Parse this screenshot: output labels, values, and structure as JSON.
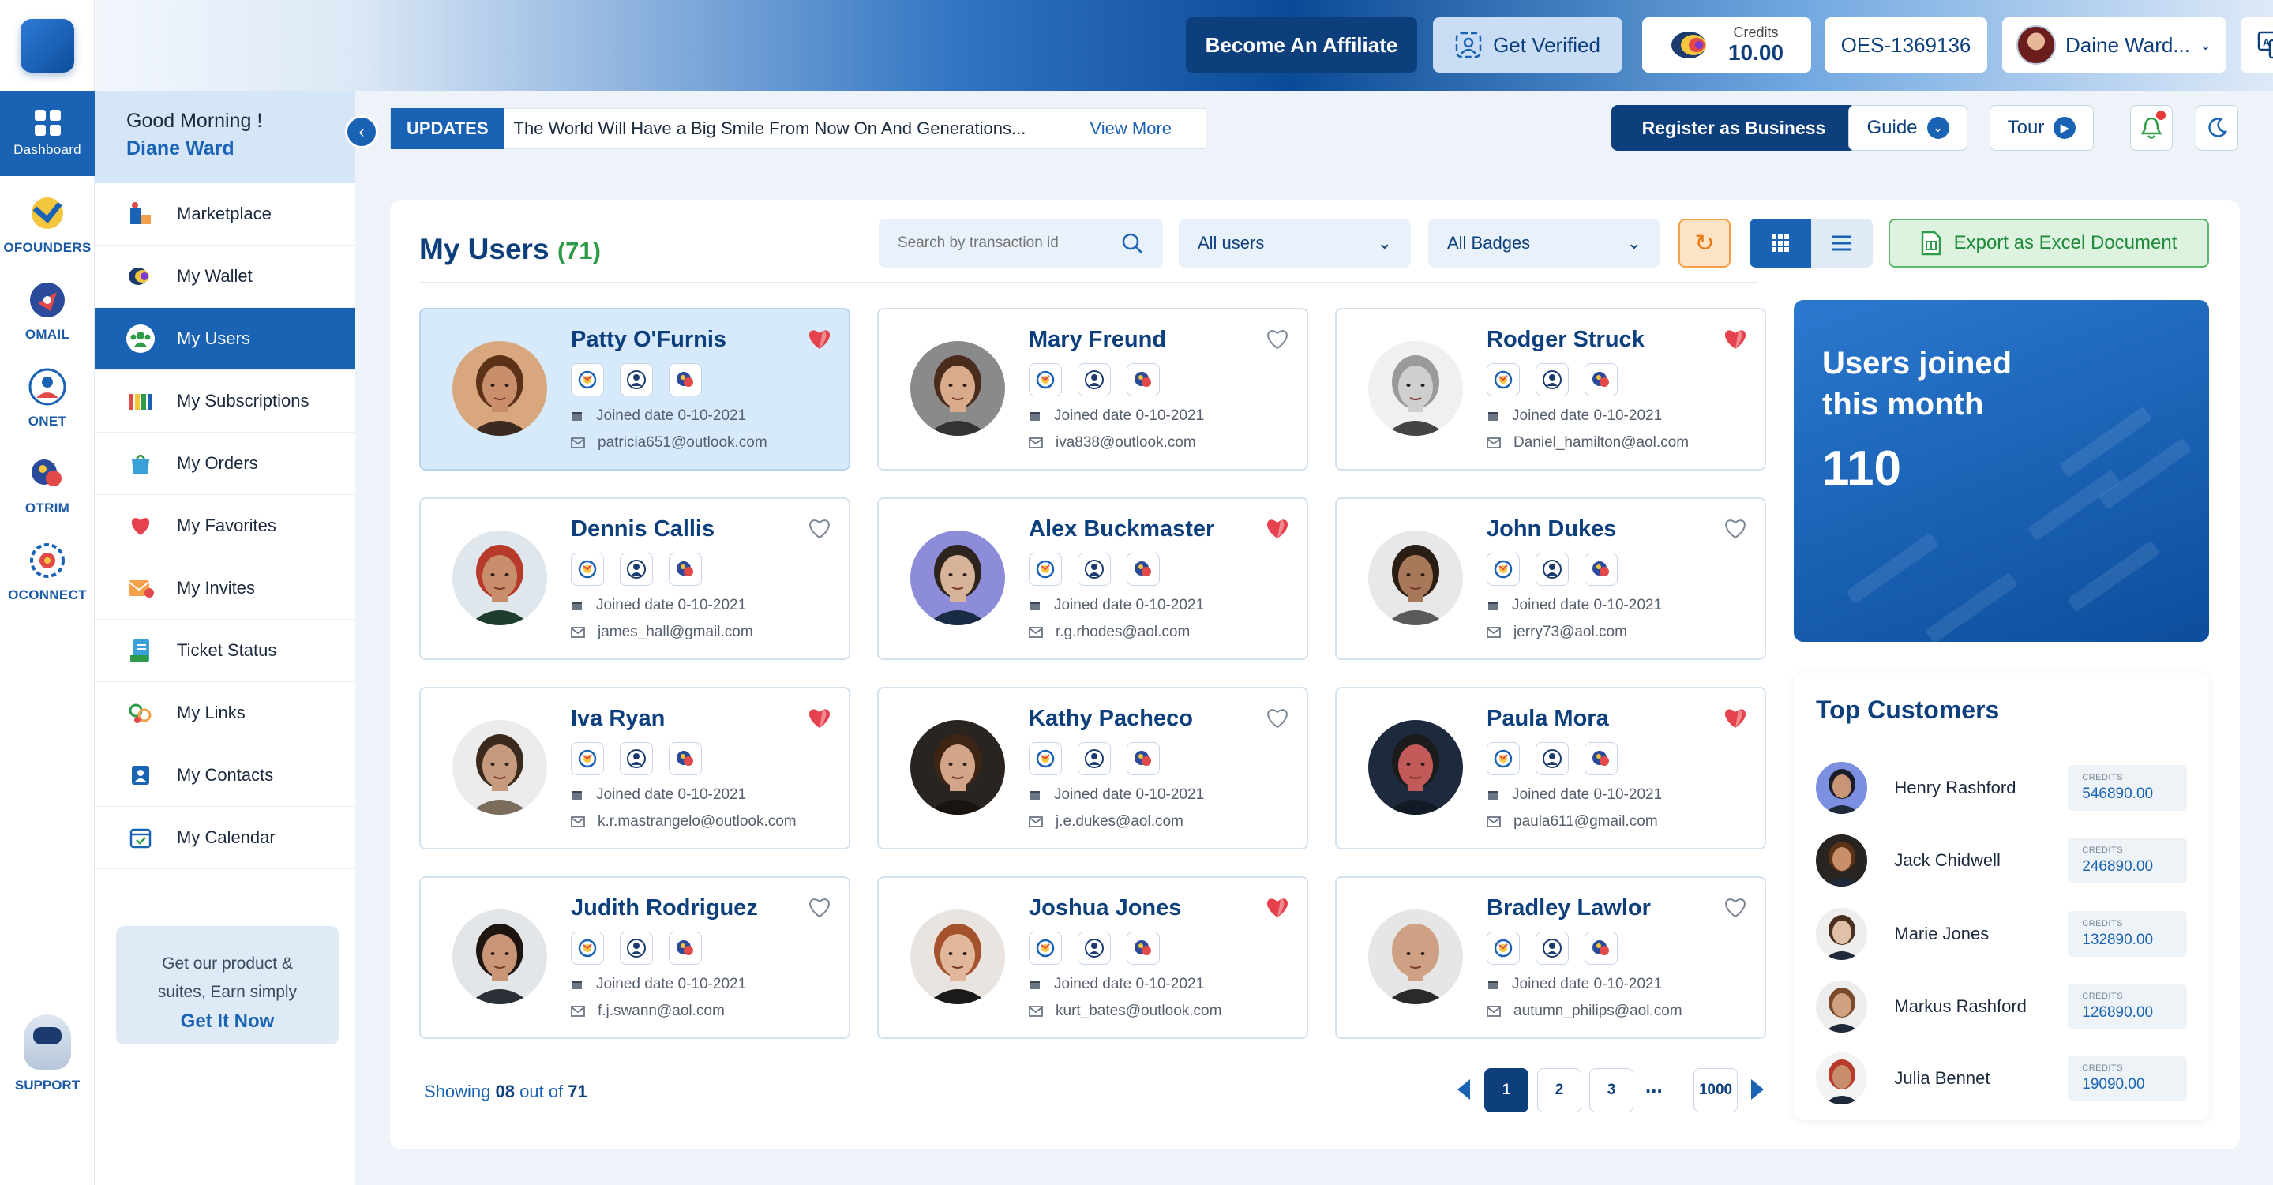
{
  "header": {
    "affiliate_label": "Become An Affiliate",
    "verify_label": "Get Verified",
    "credits_label": "Credits",
    "credits_value": "10.00",
    "account_id": "OES-1369136",
    "user_name": "Daine Ward..."
  },
  "rail": {
    "items": [
      {
        "label": "Dashboard",
        "icon": "dashboard-icon"
      },
      {
        "label": "OFOUNDERS",
        "icon": "ofounders-icon"
      },
      {
        "label": "OMAIL",
        "icon": "omail-icon"
      },
      {
        "label": "ONET",
        "icon": "onet-icon"
      },
      {
        "label": "OTRIM",
        "icon": "otrim-icon"
      },
      {
        "label": "OCONNECT",
        "icon": "oconnect-icon"
      }
    ],
    "support_label": "SUPPORT"
  },
  "sidebar": {
    "greeting": "Good Morning !",
    "user": "Diane Ward",
    "items": [
      {
        "label": "Marketplace",
        "icon": "marketplace-icon"
      },
      {
        "label": "My Wallet",
        "icon": "wallet-icon"
      },
      {
        "label": "My Users",
        "icon": "users-icon"
      },
      {
        "label": "My Subscriptions",
        "icon": "subscriptions-icon"
      },
      {
        "label": "My Orders",
        "icon": "orders-icon"
      },
      {
        "label": "My Favorites",
        "icon": "heart-icon"
      },
      {
        "label": "My Invites",
        "icon": "invite-icon"
      },
      {
        "label": "Ticket Status",
        "icon": "ticket-icon"
      },
      {
        "label": "My Links",
        "icon": "links-icon"
      },
      {
        "label": "My Contacts",
        "icon": "contacts-icon"
      },
      {
        "label": "My Calendar",
        "icon": "calendar-icon"
      }
    ],
    "promo_line1": "Get our product &",
    "promo_line2": "suites, Earn simply",
    "promo_link": "Get It Now"
  },
  "subheader": {
    "updates_tag": "UPDATES",
    "updates_text": "The World Will Have a Big Smile From Now On And Generations...",
    "view_more": "View More",
    "register_label": "Register as Business",
    "guide_label": "Guide",
    "tour_label": "Tour"
  },
  "main": {
    "title": "My Users",
    "count": "(71)",
    "search_placeholder": "Search by transaction id",
    "filter_users": "All users",
    "filter_badges": "All Badges",
    "export_label": "Export as Excel Document"
  },
  "users": [
    {
      "name": "Patty O'Furnis",
      "date": "Joined date 0-10-2021",
      "email": "patricia651@outlook.com",
      "favorite": true,
      "highlight": true,
      "skin": "#c98f6b",
      "hair": "#5b3218",
      "bg": "#d8a77e",
      "cloth": "#3b2a20"
    },
    {
      "name": "Mary Freund",
      "date": "Joined date 0-10-2021",
      "email": "iva838@outlook.com",
      "favorite": false,
      "highlight": false,
      "skin": "#d9ab8c",
      "hair": "#4a2c1c",
      "bg": "#8a8a8a",
      "cloth": "#333333"
    },
    {
      "name": "Rodger Struck",
      "date": "Joined date 0-10-2021",
      "email": "Daniel_hamilton@aol.com",
      "favorite": true,
      "highlight": false,
      "skin": "#cfcfcf",
      "hair": "#9a9a9a",
      "bg": "#f0f0f0",
      "cloth": "#444444"
    },
    {
      "name": "Dennis Callis",
      "date": "Joined date 0-10-2021",
      "email": "james_hall@gmail.com",
      "favorite": false,
      "highlight": false,
      "skin": "#c88e6b",
      "hair": "#b73a2a",
      "bg": "#dfe6ec",
      "cloth": "#1e3d2c"
    },
    {
      "name": "Alex Buckmaster",
      "date": "Joined date 0-10-2021",
      "email": "r.g.rhodes@aol.com",
      "favorite": true,
      "highlight": false,
      "skin": "#d7b39a",
      "hair": "#2d241d",
      "bg": "#8d8cd9",
      "cloth": "#1a2b45"
    },
    {
      "name": "John Dukes",
      "date": "Joined date 0-10-2021",
      "email": "jerry73@aol.com",
      "favorite": false,
      "highlight": false,
      "skin": "#a8785a",
      "hair": "#2a1d14",
      "bg": "#e8e8e8",
      "cloth": "#5a5a5a"
    },
    {
      "name": "Iva Ryan",
      "date": "Joined date 0-10-2021",
      "email": "k.r.mastrangelo@outlook.com",
      "favorite": true,
      "highlight": false,
      "skin": "#c59a7d",
      "hair": "#3a2a1e",
      "bg": "#ececec",
      "cloth": "#7c6c5c"
    },
    {
      "name": "Kathy Pacheco",
      "date": "Joined date 0-10-2021",
      "email": "j.e.dukes@aol.com",
      "favorite": false,
      "highlight": false,
      "skin": "#d2a588",
      "hair": "#3d2415",
      "bg": "#2a2420",
      "cloth": "#1a1410"
    },
    {
      "name": "Paula Mora",
      "date": "Joined date 0-10-2021",
      "email": "paula611@gmail.com",
      "favorite": true,
      "highlight": false,
      "skin": "#c25a5a",
      "hair": "#1b1b1b",
      "bg": "#1d2a3e",
      "cloth": "#121a26"
    },
    {
      "name": "Judith Rodriguez",
      "date": "Joined date 0-10-2021",
      "email": "f.j.swann@aol.com",
      "favorite": false,
      "highlight": false,
      "skin": "#c89676",
      "hair": "#1e1510",
      "bg": "#e3e6e8",
      "cloth": "#2b3036"
    },
    {
      "name": "Joshua Jones",
      "date": "Joined date 0-10-2021",
      "email": "kurt_bates@outlook.com",
      "favorite": true,
      "highlight": false,
      "skin": "#e0b79a",
      "hair": "#a3522c",
      "bg": "#e9e4df",
      "cloth": "#1a1a1a"
    },
    {
      "name": "Bradley Lawlor",
      "date": "Joined date 0-10-2021",
      "email": "autumn_philips@aol.com",
      "favorite": false,
      "highlight": false,
      "skin": "#cfa184",
      "hair": "#cfa184",
      "bg": "#e6e6e6",
      "cloth": "#2a2a2a"
    }
  ],
  "pagination": {
    "showing_prefix": "Showing",
    "showing_count": "08",
    "showing_mid": "out of",
    "showing_total": "71",
    "pages": [
      "1",
      "2",
      "3"
    ],
    "ellipsis": "...",
    "last_page": "1000",
    "current_page": "1"
  },
  "stats": {
    "title": "Users joined this month",
    "value": "110"
  },
  "top_customers": {
    "title": "Top Customers",
    "credits_label": "CREDITS",
    "items": [
      {
        "name": "Henry Rashford",
        "credits": "546890.00",
        "skin": "#c89676",
        "bg": "#7d8fe0",
        "hair": "#1b1b2a"
      },
      {
        "name": "Jack Chidwell",
        "credits": "246890.00",
        "skin": "#c98f6b",
        "bg": "#2a2420",
        "hair": "#5b3218"
      },
      {
        "name": "Marie Jones",
        "credits": "132890.00",
        "skin": "#e0c0a8",
        "bg": "#f0eeec",
        "hair": "#4a3020"
      },
      {
        "name": "Markus Rashford",
        "credits": "126890.00",
        "skin": "#d0a080",
        "bg": "#ededed",
        "hair": "#7a4a2a"
      },
      {
        "name": "Julia Bennet",
        "credits": "19090.00",
        "skin": "#c88e6b",
        "bg": "#f3f3f3",
        "hair": "#b73a2a"
      }
    ]
  },
  "colors": {
    "primary": "#1a63b4",
    "dark": "#0d3f7c",
    "favorite": "#e5424d",
    "success": "#2e9b48"
  }
}
